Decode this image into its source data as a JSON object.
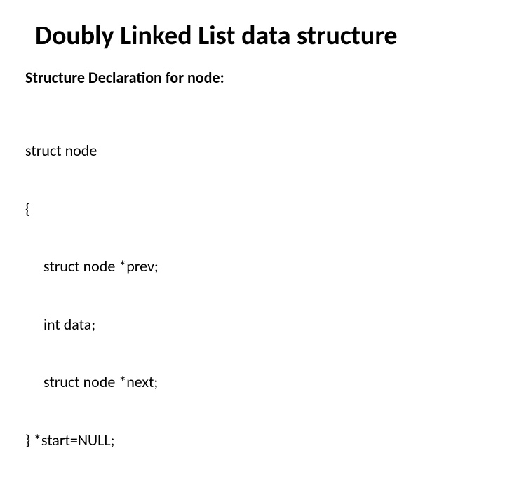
{
  "title": "Doubly Linked List data structure",
  "subheading": "Structure Declaration for node:",
  "code": {
    "l1": "struct node",
    "l2": "{",
    "l3": "struct node *prev;",
    "l4": "int data;",
    "l5": "struct node *next;",
    "l6": "} *start=NULL;"
  }
}
